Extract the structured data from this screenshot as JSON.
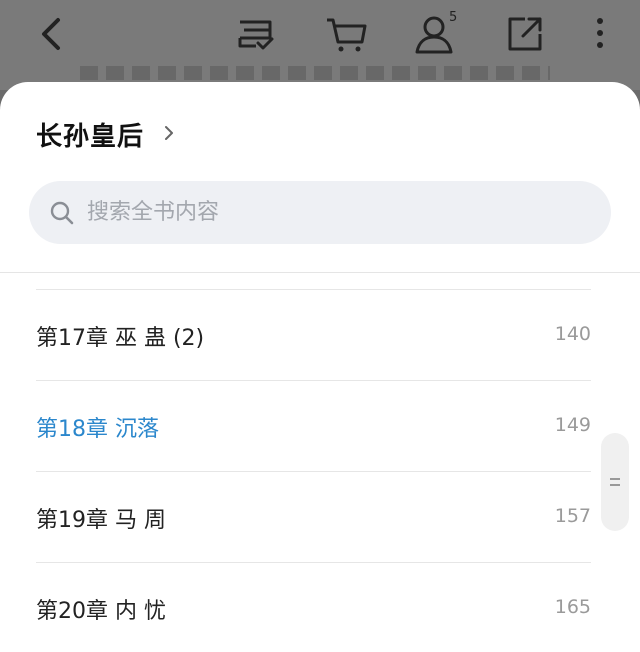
{
  "topbar": {
    "notification_count": "5",
    "icons": [
      "back-arrow-icon",
      "bookmark-list-icon",
      "cart-icon",
      "user-icon",
      "share-external-icon",
      "more-vertical-icon"
    ]
  },
  "sheet": {
    "book_title": "长孙皇后",
    "search": {
      "placeholder": "搜索全书内容",
      "value": ""
    },
    "chapters": [
      {
        "title": "第17章 巫 蛊 (2)",
        "page": "140",
        "current": false
      },
      {
        "title": "第18章 沉落",
        "page": "149",
        "current": true
      },
      {
        "title": "第19章 马 周",
        "page": "157",
        "current": false
      },
      {
        "title": "第20章 内 忧",
        "page": "165",
        "current": false
      }
    ]
  },
  "colors": {
    "accent": "#2b87cc",
    "overlay": "#7a7a7a",
    "search_bg": "#eef0f4"
  }
}
